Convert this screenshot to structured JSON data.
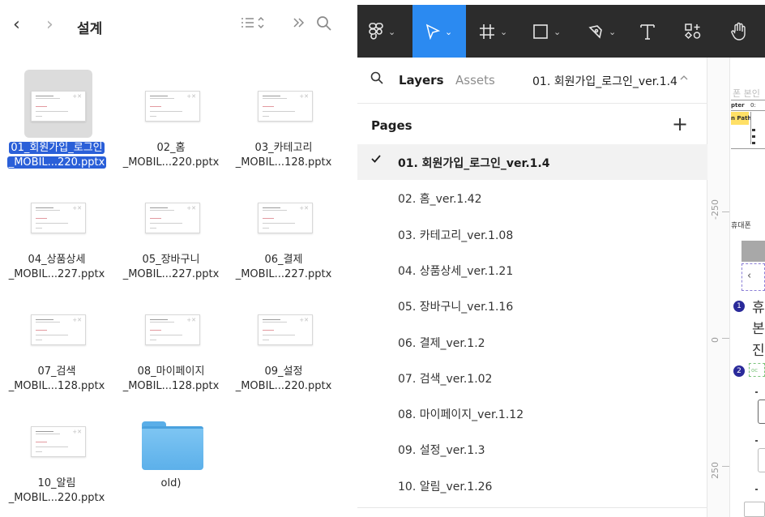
{
  "finder": {
    "title": "설계",
    "back_icon": "‹",
    "forward_icon": "›",
    "files": [
      {
        "name_l1": "01_회원가입_로그인",
        "name_l2": "_MOBIL...220.pptx",
        "selected": true
      },
      {
        "name_l1": "02_홈",
        "name_l2": "_MOBIL...220.pptx"
      },
      {
        "name_l1": "03_카테고리",
        "name_l2": "_MOBIL...128.pptx"
      },
      {
        "name_l1": "04_상품상세",
        "name_l2": "_MOBIL...227.pptx"
      },
      {
        "name_l1": "05_장바구니",
        "name_l2": "_MOBIL...227.pptx"
      },
      {
        "name_l1": "06_결제",
        "name_l2": "_MOBIL...227.pptx"
      },
      {
        "name_l1": "07_검색",
        "name_l2": "_MOBIL...128.pptx"
      },
      {
        "name_l1": "08_마이페이지",
        "name_l2": "_MOBIL...128.pptx"
      },
      {
        "name_l1": "09_설정",
        "name_l2": "_MOBIL...220.pptx"
      },
      {
        "name_l1": "10_알림",
        "name_l2": "_MOBIL...220.pptx"
      }
    ],
    "folder": {
      "name": "old)"
    }
  },
  "figma": {
    "tabs": {
      "layers": "Layers",
      "assets": "Assets"
    },
    "current_page": "01. 회원가입_로그인_ver.1.4",
    "pages_header": "Pages",
    "add_page": "+",
    "pages": [
      "01. 회원가입_로그인_ver.1.4",
      "02. 홈_ver.1.42",
      "03. 카테고리_ver.1.08",
      "04. 상품상세_ver.1.21",
      "05. 장바구니_ver.1.16",
      "06. 결제_ver.1.2",
      "07. 검색_ver.1.02",
      "08. 마이페이지_ver.1.12",
      "09. 설정_ver.1.3",
      "10. 알림_ver.1.26"
    ],
    "ruler_ticks": [
      "-250",
      "0",
      "250"
    ],
    "canvas": {
      "t1": "폰 본인",
      "t2": "pter",
      "t3": "0:",
      "t4": "n Path",
      "t5": "휴대폰",
      "t6": "‹",
      "t7": "휴",
      "t8": "본",
      "t9": "진",
      "t10": "oc",
      "b1": "1",
      "b2": "2"
    }
  },
  "colors": {
    "accent": "#2b8af1",
    "selection": "#2a5fd8",
    "toolbar": "#2c2c2c"
  }
}
